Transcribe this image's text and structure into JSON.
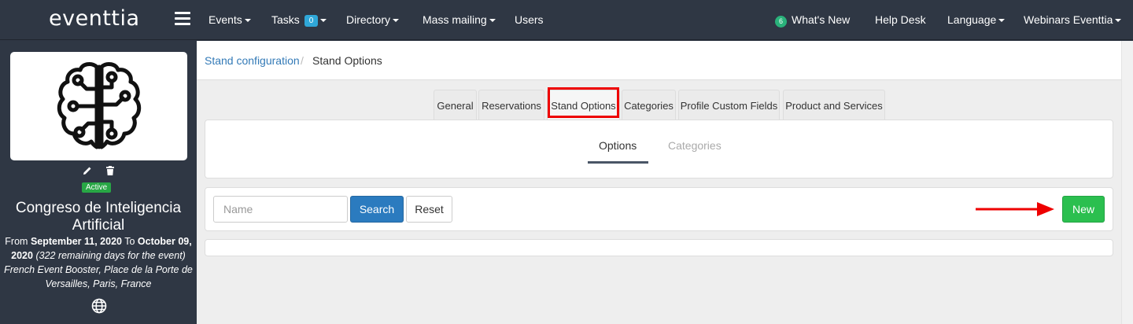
{
  "brand": {
    "logo": "eventtia"
  },
  "nav": {
    "events": "Events",
    "tasks": "Tasks",
    "tasks_count": "0",
    "directory": "Directory",
    "mass_mailing": "Mass mailing",
    "users": "Users",
    "whats_new_count": "6",
    "whats_new": "What's New",
    "help_desk": "Help Desk",
    "language": "Language",
    "account": "Webinars Eventtia"
  },
  "sidebar": {
    "status": "Active",
    "event_title": "Congreso de Inteligencia Artificial",
    "from_label": "From",
    "start_date": "September 11, 2020",
    "to_label": "To",
    "end_date": "October 09, 2020",
    "remaining": "(322 remaining days for the event)",
    "location": "French Event Booster, Place de la Porte de Versailles, Paris, France"
  },
  "breadcrumb": {
    "parent": "Stand configuration",
    "separator": "/",
    "current": "Stand Options"
  },
  "tabs": [
    "General",
    "Reservations",
    "Stand Options",
    "Categories",
    "Profile Custom Fields",
    "Product and Services"
  ],
  "active_tab": "Stand Options",
  "subtabs": {
    "options": "Options",
    "categories": "Categories",
    "active": "Options"
  },
  "search": {
    "placeholder": "Name",
    "search_button": "Search",
    "reset_button": "Reset",
    "new_button": "New"
  },
  "colors": {
    "navbar": "#2f3744",
    "link": "#337ab7",
    "primary": "#2b7bbf",
    "success": "#2bbf4f",
    "highlight": "#ee0000"
  }
}
